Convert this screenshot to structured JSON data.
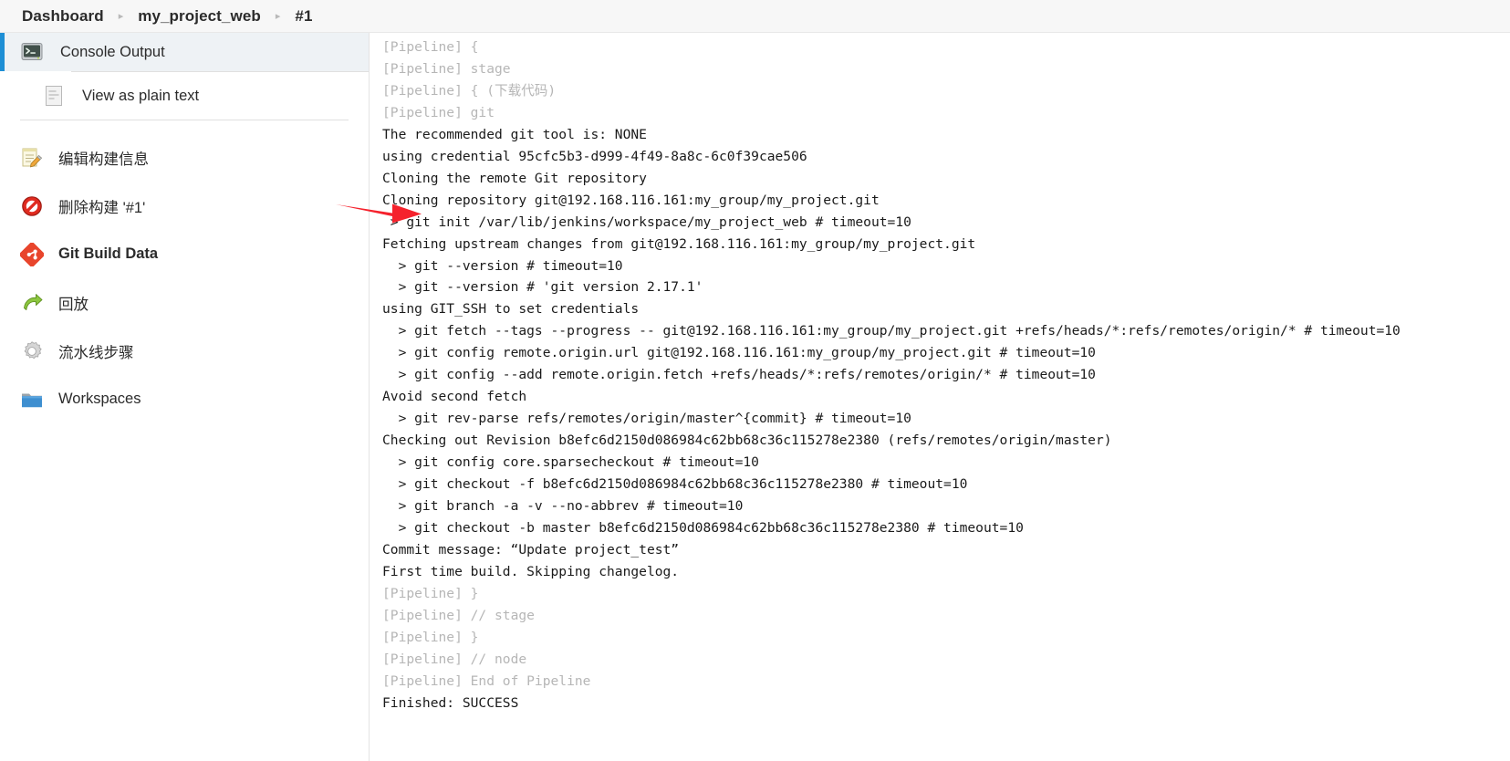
{
  "breadcrumb": {
    "separator": "▸",
    "items": [
      {
        "label": "Dashboard",
        "name": "breadcrumb-dashboard"
      },
      {
        "label": "my_project_web",
        "name": "breadcrumb-project"
      },
      {
        "label": "#1",
        "name": "breadcrumb-build"
      }
    ]
  },
  "sidebar": {
    "console_output": {
      "label": "Console Output",
      "icon": "terminal-icon",
      "selected": true,
      "accent_color": "#1e8fd5"
    },
    "view_plain_text": {
      "label": "View as plain text",
      "icon": "document-icon"
    },
    "items": [
      {
        "label": "编辑构建信息",
        "icon": "edit-note-icon"
      },
      {
        "label": "删除构建 '#1'",
        "icon": "delete-forbidden-icon"
      },
      {
        "label": "Git Build Data",
        "icon": "git-icon",
        "bold": true
      },
      {
        "label": "回放",
        "icon": "replay-arrow-icon"
      },
      {
        "label": "流水线步骤",
        "icon": "gear-icon"
      },
      {
        "label": "Workspaces",
        "icon": "folder-icon"
      }
    ]
  },
  "annotation": {
    "arrow": {
      "color": "#f5222d",
      "points_at_line_index": 9,
      "name": "red-arrow-annotation"
    }
  },
  "console": {
    "lines": [
      {
        "text": "[Pipeline] {",
        "dim": true
      },
      {
        "text": "[Pipeline] stage",
        "dim": true
      },
      {
        "text": "[Pipeline] { (下载代码)",
        "dim": true
      },
      {
        "text": "[Pipeline] git",
        "dim": true
      },
      {
        "text": "The recommended git tool is: NONE",
        "dim": false
      },
      {
        "text": "using credential 95cfc5b3-d999-4f49-8a8c-6c0f39cae506",
        "dim": false
      },
      {
        "text": "Cloning the remote Git repository",
        "dim": false
      },
      {
        "text": "Cloning repository git@192.168.116.161:my_group/my_project.git",
        "dim": false
      },
      {
        "text": " > git init /var/lib/jenkins/workspace/my_project_web # timeout=10",
        "dim": false
      },
      {
        "text": "Fetching upstream changes from git@192.168.116.161:my_group/my_project.git",
        "dim": false
      },
      {
        "text": "  > git --version # timeout=10",
        "dim": false
      },
      {
        "text": "  > git --version # 'git version 2.17.1'",
        "dim": false
      },
      {
        "text": "using GIT_SSH to set credentials",
        "dim": false
      },
      {
        "text": "  > git fetch --tags --progress -- git@192.168.116.161:my_group/my_project.git +refs/heads/*:refs/remotes/origin/* # timeout=10",
        "dim": false
      },
      {
        "text": "  > git config remote.origin.url git@192.168.116.161:my_group/my_project.git # timeout=10",
        "dim": false
      },
      {
        "text": "  > git config --add remote.origin.fetch +refs/heads/*:refs/remotes/origin/* # timeout=10",
        "dim": false
      },
      {
        "text": "Avoid second fetch",
        "dim": false
      },
      {
        "text": "  > git rev-parse refs/remotes/origin/master^{commit} # timeout=10",
        "dim": false
      },
      {
        "text": "Checking out Revision b8efc6d2150d086984c62bb68c36c115278e2380 (refs/remotes/origin/master)",
        "dim": false
      },
      {
        "text": "  > git config core.sparsecheckout # timeout=10",
        "dim": false
      },
      {
        "text": "  > git checkout -f b8efc6d2150d086984c62bb68c36c115278e2380 # timeout=10",
        "dim": false
      },
      {
        "text": "  > git branch -a -v --no-abbrev # timeout=10",
        "dim": false
      },
      {
        "text": "  > git checkout -b master b8efc6d2150d086984c62bb68c36c115278e2380 # timeout=10",
        "dim": false
      },
      {
        "text": "Commit message: “Update project_test”",
        "dim": false
      },
      {
        "text": "First time build. Skipping changelog.",
        "dim": false
      },
      {
        "text": "[Pipeline] }",
        "dim": true
      },
      {
        "text": "[Pipeline] // stage",
        "dim": true
      },
      {
        "text": "[Pipeline] }",
        "dim": true
      },
      {
        "text": "[Pipeline] // node",
        "dim": true
      },
      {
        "text": "[Pipeline] End of Pipeline",
        "dim": true
      },
      {
        "text": "Finished: SUCCESS",
        "dim": false
      }
    ]
  }
}
